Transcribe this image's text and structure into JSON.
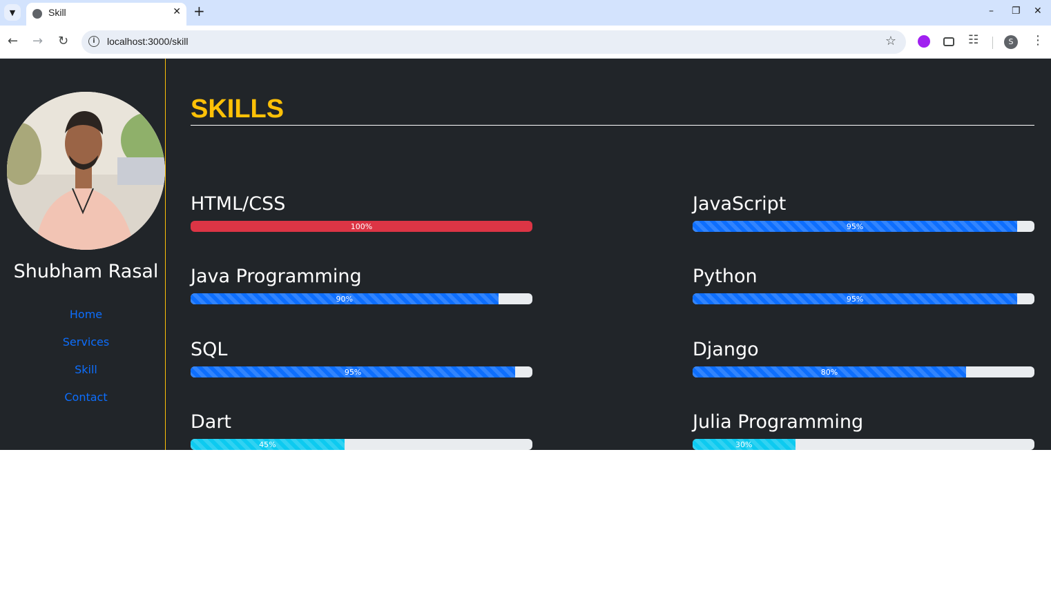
{
  "browser": {
    "tab_title": "Skill",
    "url": "localhost:3000/skill",
    "profile_initial": "S"
  },
  "sidebar": {
    "name": "Shubham Rasal",
    "nav": [
      {
        "label": "Home"
      },
      {
        "label": "Services"
      },
      {
        "label": "Skill"
      },
      {
        "label": "Contact"
      }
    ]
  },
  "main": {
    "heading": "SKILLS",
    "skills": [
      {
        "name": "HTML/CSS",
        "percent": 100,
        "label": "100%",
        "color": "#dc3545",
        "striped": false
      },
      {
        "name": "JavaScript",
        "percent": 95,
        "label": "95%",
        "color": "#0d6efd",
        "striped": true
      },
      {
        "name": "Java Programming",
        "percent": 90,
        "label": "90%",
        "color": "#0d6efd",
        "striped": true
      },
      {
        "name": "Python",
        "percent": 95,
        "label": "95%",
        "color": "#0d6efd",
        "striped": true
      },
      {
        "name": "SQL",
        "percent": 95,
        "label": "95%",
        "color": "#0d6efd",
        "striped": true
      },
      {
        "name": "Django",
        "percent": 80,
        "label": "80%",
        "color": "#0d6efd",
        "striped": true
      },
      {
        "name": "Dart",
        "percent": 45,
        "label": "45%",
        "color": "#0dcaf0",
        "striped": true
      },
      {
        "name": "Julia Programming",
        "percent": 30,
        "label": "30%",
        "color": "#0dcaf0",
        "striped": true
      }
    ]
  },
  "colors": {
    "page_bg": "#212529",
    "accent": "#ffc107",
    "link": "#0d6efd"
  }
}
